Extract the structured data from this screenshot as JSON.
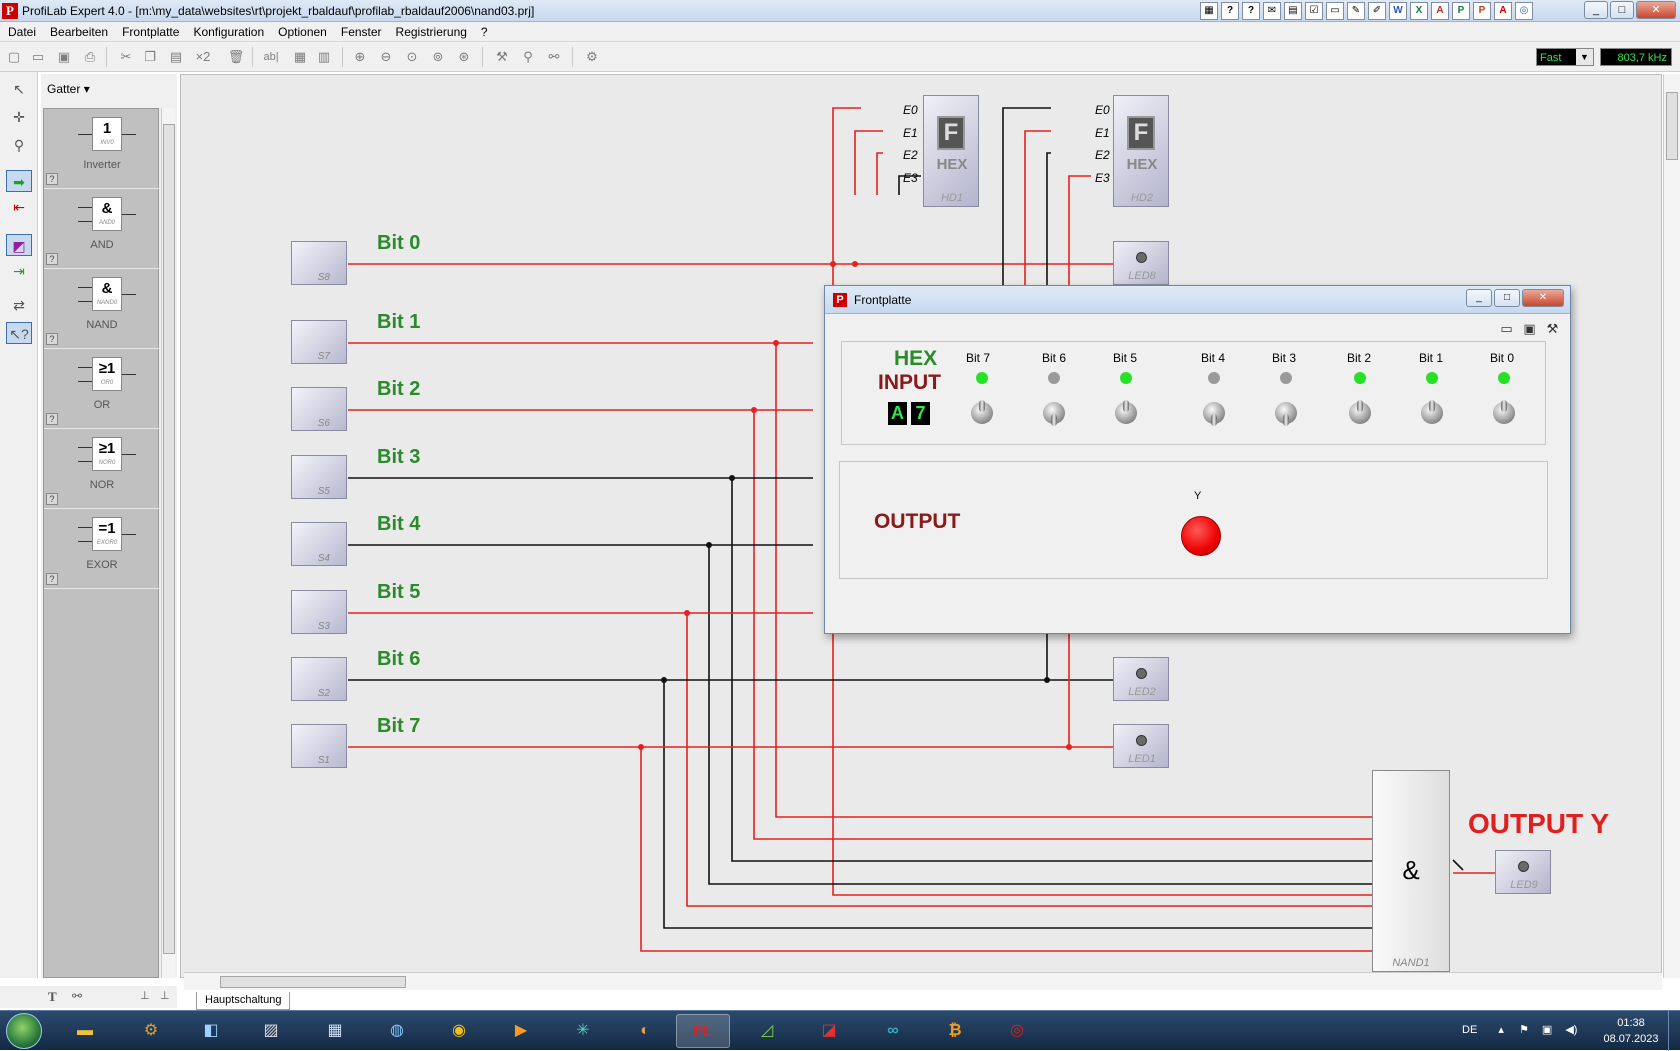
{
  "window": {
    "title": "ProfiLab Expert 4.0 - [m:\\my_data\\websites\\rt\\projekt_rbaldauf\\profilab_rbaldauf2006\\nand03.prj]",
    "app_icon": "profilab-icon"
  },
  "menu": [
    "Datei",
    "Bearbeiten",
    "Frontplatte",
    "Konfiguration",
    "Optionen",
    "Fenster",
    "Registrierung",
    "?"
  ],
  "toolbar": {
    "copy_count": "×2",
    "text_tool": "ab|",
    "speed": "Fast",
    "frequency": "803,7 kHz"
  },
  "palette": {
    "category": "Gatter",
    "items": [
      {
        "name": "Inverter",
        "symbol": "1",
        "sub": "INV0"
      },
      {
        "name": "AND",
        "symbol": "&",
        "sub": "AND0"
      },
      {
        "name": "NAND",
        "symbol": "&",
        "sub": "NAND0"
      },
      {
        "name": "OR",
        "symbol": "≥1",
        "sub": "OR0"
      },
      {
        "name": "NOR",
        "symbol": "≥1",
        "sub": "NOR0"
      },
      {
        "name": "EXOR",
        "symbol": "=1",
        "sub": "EXOR0"
      }
    ],
    "help": "?"
  },
  "circuit": {
    "switches": [
      {
        "label": "S8",
        "bit": "Bit 0"
      },
      {
        "label": "S7",
        "bit": "Bit 1"
      },
      {
        "label": "S6",
        "bit": "Bit 2"
      },
      {
        "label": "S5",
        "bit": "Bit 3"
      },
      {
        "label": "S4",
        "bit": "Bit 4"
      },
      {
        "label": "S3",
        "bit": "Bit 5"
      },
      {
        "label": "S2",
        "bit": "Bit 6"
      },
      {
        "label": "S1",
        "bit": "Bit 7"
      }
    ],
    "hex1": {
      "digit": "F",
      "text": "HEX",
      "label": "HD1"
    },
    "hex2": {
      "digit": "F",
      "text": "HEX",
      "label": "HD2"
    },
    "pins": [
      "E0",
      "E1",
      "E2",
      "E3"
    ],
    "leds": [
      "LED8",
      "LED2",
      "LED1",
      "LED9"
    ],
    "gate": {
      "symbol": "&",
      "label": "NAND1"
    },
    "output_label": "OUTPUT Y"
  },
  "sheet_tab": "Hauptschaltung",
  "frontplatte": {
    "title": "Frontplatte",
    "hex_line1": "HEX",
    "hex_line2": "INPUT",
    "digit_high": "A",
    "digit_low": "7",
    "bits": [
      {
        "label": "Bit 7",
        "on": true
      },
      {
        "label": "Bit 6",
        "on": false
      },
      {
        "label": "Bit 5",
        "on": true
      },
      {
        "label": "Bit 4",
        "on": false
      },
      {
        "label": "Bit 3",
        "on": false
      },
      {
        "label": "Bit 2",
        "on": true
      },
      {
        "label": "Bit 1",
        "on": true
      },
      {
        "label": "Bit 0",
        "on": true
      }
    ],
    "output_label": "OUTPUT",
    "y_label": "Y"
  },
  "taskbar": {
    "language": "DE",
    "time": "01:38",
    "date": "08.07.2023"
  },
  "colors": {
    "wire_high": "#e62020",
    "wire_low": "#111111",
    "label_green": "#2b8a2b",
    "label_dark_red": "#8a1a1a",
    "output_red": "#e02020"
  }
}
